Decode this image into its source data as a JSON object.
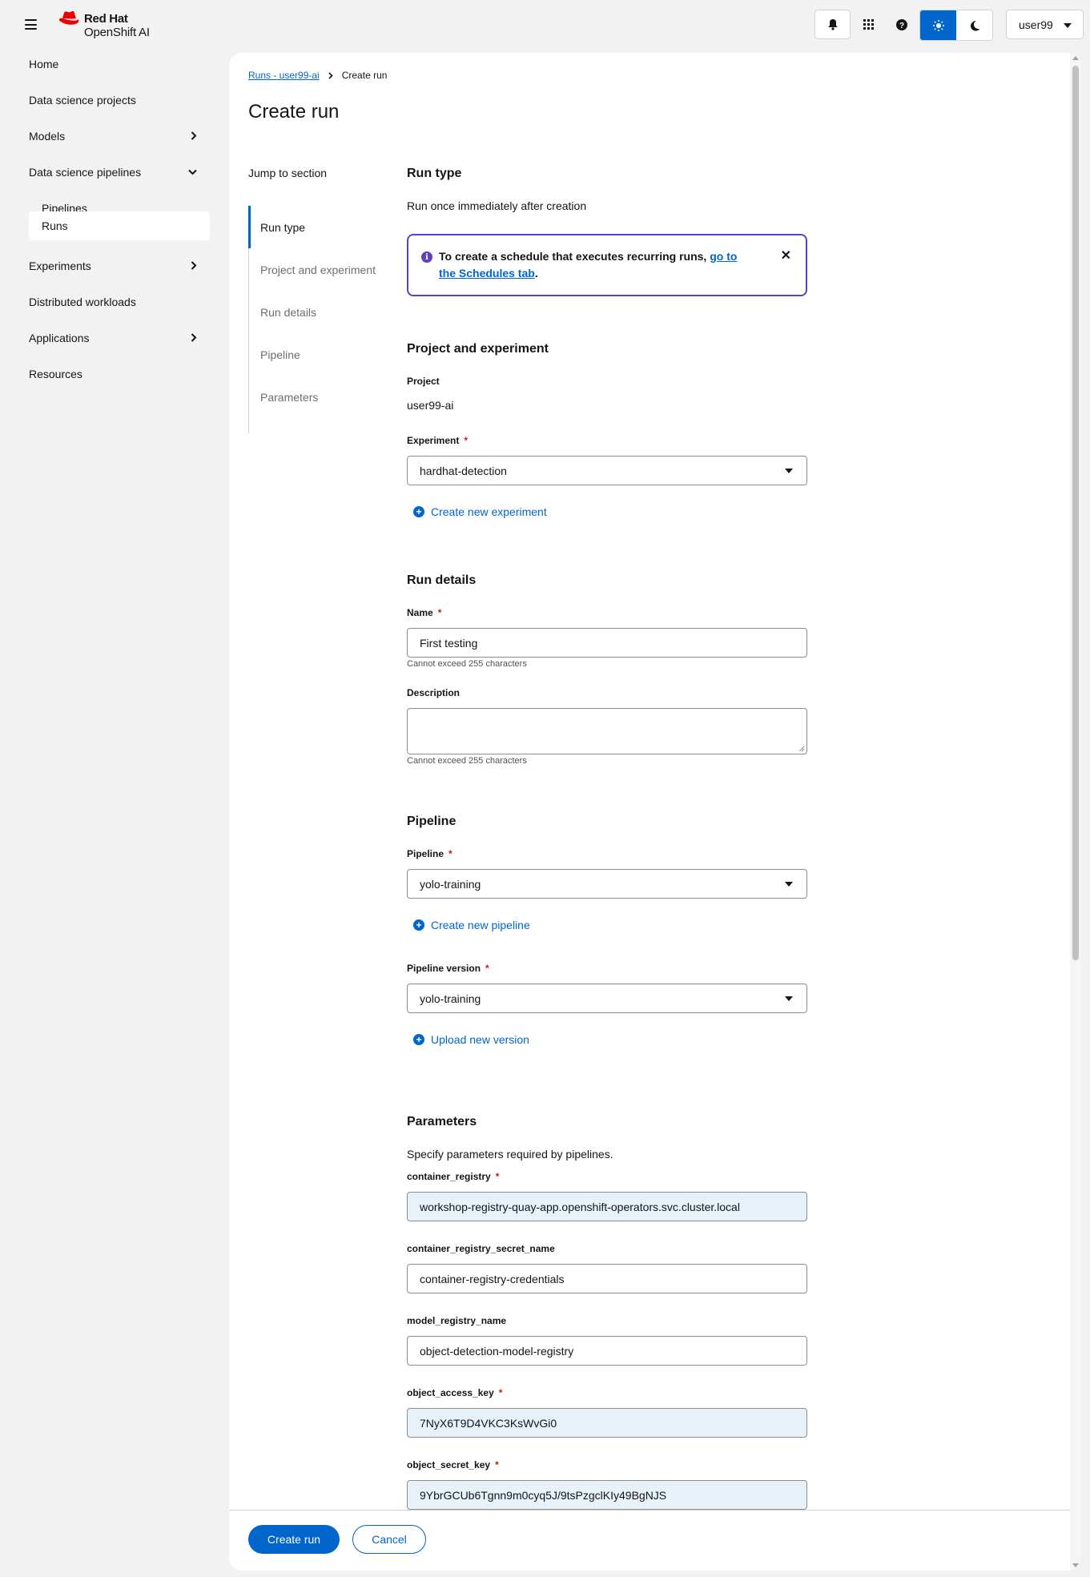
{
  "brand": {
    "line1": "Red Hat",
    "line2": "OpenShift AI"
  },
  "masthead": {
    "icons": [
      "menu-icon",
      "bell-icon",
      "apps-grid-icon",
      "help-icon",
      "sun-icon",
      "moon-icon"
    ],
    "user": "user99"
  },
  "sidebar": {
    "items": [
      {
        "label": "Home"
      },
      {
        "label": "Data science projects"
      },
      {
        "label": "Models"
      },
      {
        "label": "Data science pipelines"
      },
      {
        "label": "Pipelines"
      },
      {
        "label": "Runs"
      },
      {
        "label": "Experiments"
      },
      {
        "label": "Distributed workloads"
      },
      {
        "label": "Applications"
      },
      {
        "label": "Resources"
      }
    ]
  },
  "breadcrumb": {
    "parent": "Runs - user99-ai",
    "current": "Create run"
  },
  "page": {
    "title": "Create run"
  },
  "jump": {
    "title": "Jump to section",
    "items": [
      "Run type",
      "Project and experiment",
      "Run details",
      "Pipeline",
      "Parameters"
    ]
  },
  "run_type": {
    "heading": "Run type",
    "text": "Run once immediately after creation",
    "alert_text": "To create a schedule that executes recurring runs, ",
    "alert_link": "go to the Schedules tab",
    "alert_end": "."
  },
  "project": {
    "heading": "Project and experiment",
    "project_label": "Project",
    "project_value": "user99-ai",
    "experiment_label": "Experiment",
    "experiment_value": "hardhat-detection",
    "create_experiment": "Create new experiment"
  },
  "run_details": {
    "heading": "Run details",
    "name_label": "Name",
    "name_value": "First testing",
    "name_helper": "Cannot exceed 255 characters",
    "desc_label": "Description",
    "desc_value": "",
    "desc_helper": "Cannot exceed 255 characters"
  },
  "pipeline": {
    "heading": "Pipeline",
    "pipeline_label": "Pipeline",
    "pipeline_value": "yolo-training",
    "create_pipeline": "Create new pipeline",
    "version_label": "Pipeline version",
    "version_value": "yolo-training",
    "upload_version": "Upload new version"
  },
  "parameters": {
    "heading": "Parameters",
    "text": "Specify parameters required by pipelines.",
    "fields": [
      {
        "label": "container_registry",
        "value": "workshop-registry-quay-app.openshift-operators.svc.cluster.local",
        "required": true
      },
      {
        "label": "container_registry_secret_name",
        "value": "container-registry-credentials",
        "required": false
      },
      {
        "label": "model_registry_name",
        "value": "object-detection-model-registry",
        "required": false
      },
      {
        "label": "object_access_key",
        "value": "7NyX6T9D4VKC3KsWvGi0",
        "required": true
      },
      {
        "label": "object_secret_key",
        "value": "9YbrGCUb6Tgnn9m0cyq5J/9tsPzgclKIy49BgNJS",
        "required": true
      }
    ]
  },
  "footer": {
    "create_label": "Create run",
    "cancel_label": "Cancel"
  },
  "colors": {
    "primary": "#0066cc",
    "alert_border": "#5e40be",
    "required": "#c9190b",
    "filled_input": "#e7f1fa"
  }
}
